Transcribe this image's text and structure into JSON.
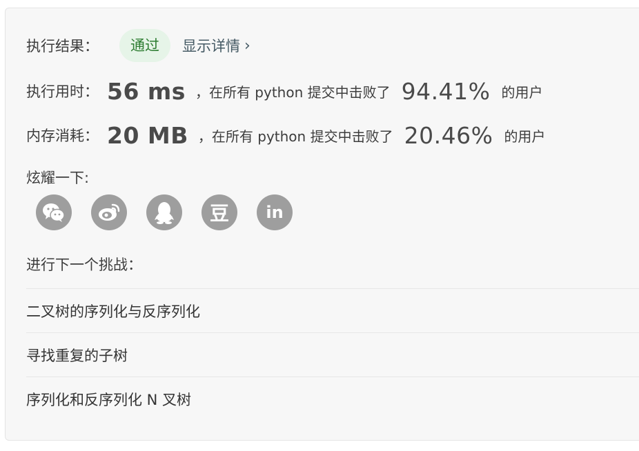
{
  "result": {
    "label": "执行结果：",
    "status": "通过",
    "details_link": "显示详情",
    "details_chevron": "›"
  },
  "runtime": {
    "label": "执行用时：",
    "value": "56 ms",
    "mid_text": "，在所有 python 提交中击败了",
    "percent": "94.41%",
    "suffix": "的用户"
  },
  "memory": {
    "label": "内存消耗：",
    "value": "20 MB",
    "mid_text": "，在所有 python 提交中击败了",
    "percent": "20.46%",
    "suffix": "的用户"
  },
  "share": {
    "label": "炫耀一下:",
    "icons": [
      "wechat-icon",
      "weibo-icon",
      "qq-icon",
      "douban-icon",
      "linkedin-icon"
    ],
    "douban_glyph": "豆",
    "linkedin_glyph": "in",
    "icon_color": "#9e9e9e"
  },
  "next": {
    "label": "进行下一个挑战：",
    "items": [
      "二叉树的序列化与反序列化",
      "寻找重复的子树",
      "序列化和反序列化 N 叉树"
    ]
  },
  "colors": {
    "pass_bg": "#e6f4e8",
    "pass_text": "#2e7d32",
    "link": "#455a64"
  }
}
